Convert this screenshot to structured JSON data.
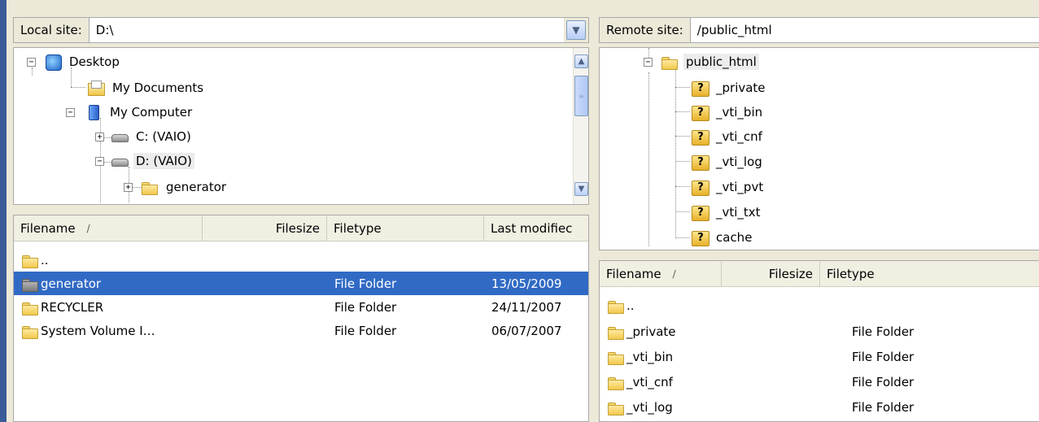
{
  "local": {
    "site_label": "Local site:",
    "site_value": "D:\\",
    "tree": [
      {
        "label": "Desktop",
        "icon": "desktop-icon",
        "expander": "−"
      },
      {
        "label": "My Documents",
        "icon": "my-documents-icon",
        "expander": ""
      },
      {
        "label": "My Computer",
        "icon": "my-computer-icon",
        "expander": "−"
      },
      {
        "label": "C: (VAIO)",
        "icon": "drive-icon",
        "expander": "+"
      },
      {
        "label": "D: (VAIO)",
        "icon": "drive-icon",
        "expander": "−"
      },
      {
        "label": "generator",
        "icon": "folder-icon",
        "expander": "+"
      }
    ],
    "columns": [
      "Filename",
      "Filesize",
      "Filetype",
      "Last modifiec"
    ],
    "sort_mark": "/",
    "files": [
      {
        "name": "..",
        "size": "",
        "type": "",
        "modified": ""
      },
      {
        "name": "generator",
        "size": "",
        "type": "File Folder",
        "modified": "13/05/2009"
      },
      {
        "name": "RECYCLER",
        "size": "",
        "type": "File Folder",
        "modified": "24/11/2007"
      },
      {
        "name": "System Volume I…",
        "size": "",
        "type": "File Folder",
        "modified": "06/07/2007"
      }
    ]
  },
  "remote": {
    "site_label": "Remote site:",
    "site_value": "/public_html",
    "tree": [
      {
        "label": "public_html",
        "icon": "folder-icon",
        "expander": "−"
      },
      {
        "label": "_private",
        "icon": "unknown-folder-icon"
      },
      {
        "label": "_vti_bin",
        "icon": "unknown-folder-icon"
      },
      {
        "label": "_vti_cnf",
        "icon": "unknown-folder-icon"
      },
      {
        "label": "_vti_log",
        "icon": "unknown-folder-icon"
      },
      {
        "label": "_vti_pvt",
        "icon": "unknown-folder-icon"
      },
      {
        "label": "_vti_txt",
        "icon": "unknown-folder-icon"
      },
      {
        "label": "cache",
        "icon": "unknown-folder-icon"
      }
    ],
    "columns": [
      "Filename",
      "Filesize",
      "Filetype"
    ],
    "sort_mark": "/",
    "files": [
      {
        "name": "..",
        "size": "",
        "type": ""
      },
      {
        "name": "_private",
        "size": "",
        "type": "File Folder"
      },
      {
        "name": "_vti_bin",
        "size": "",
        "type": "File Folder"
      },
      {
        "name": "_vti_cnf",
        "size": "",
        "type": "File Folder"
      },
      {
        "name": "_vti_log",
        "size": "",
        "type": "File Folder"
      }
    ]
  },
  "colors": {
    "selection": "#316ac5",
    "accent_bar": "#3b5c9a"
  }
}
